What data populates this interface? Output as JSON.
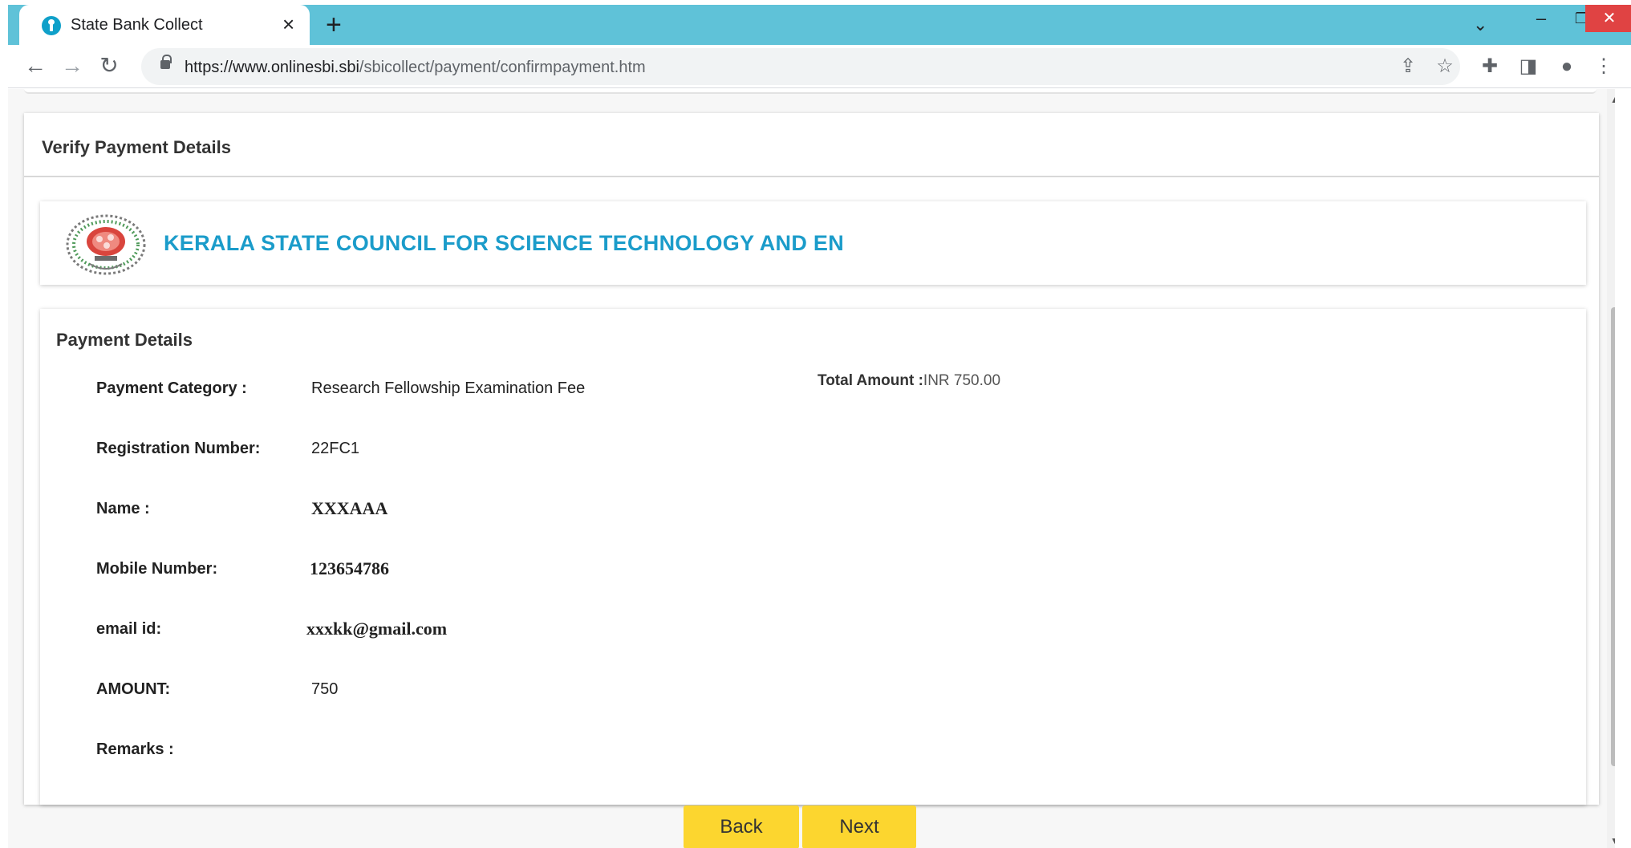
{
  "browser": {
    "tab_title": "State Bank Collect",
    "tab_close": "×",
    "new_tab": "+",
    "url_host": "https://www.onlinesbi.sbi",
    "url_path": "/sbicollect/payment/confirmpayment.htm",
    "icons": {
      "back": "arrow-left-icon",
      "forward": "arrow-right-icon",
      "reload": "reload-icon",
      "lock": "lock-icon",
      "share": "share-icon",
      "bookmark": "star-icon",
      "extensions": "puzzle-icon",
      "side_panel": "side-panel-icon",
      "profile": "profile-icon",
      "menu": "kebab-menu-icon"
    }
  },
  "page": {
    "section_title": "Verify Payment Details",
    "organization": "KERALA STATE COUNCIL FOR SCIENCE TECHNOLOGY AND EN",
    "details_title": "Payment Details",
    "total_amount_label": "Total Amount :",
    "total_amount_value": "INR 750.00",
    "fields": [
      {
        "label": "Payment Category :",
        "value": "Research Fellowship Examination Fee"
      },
      {
        "label": "Registration Number:",
        "value": "22FC1"
      },
      {
        "label": "Name :",
        "value": "XXXAAA"
      },
      {
        "label": "Mobile Number:",
        "value": "123654786"
      },
      {
        "label": "email id:",
        "value": "xxxkk@gmail.com"
      },
      {
        "label": "AMOUNT:",
        "value": "750"
      },
      {
        "label": "Remarks :",
        "value": ""
      }
    ],
    "buttons": {
      "back": "Back",
      "next": "Next"
    }
  },
  "colors": {
    "tab_strip": "#5fc2d8",
    "org_name": "#1b9cca",
    "button": "#fcd62f",
    "window_close": "#e04343"
  }
}
